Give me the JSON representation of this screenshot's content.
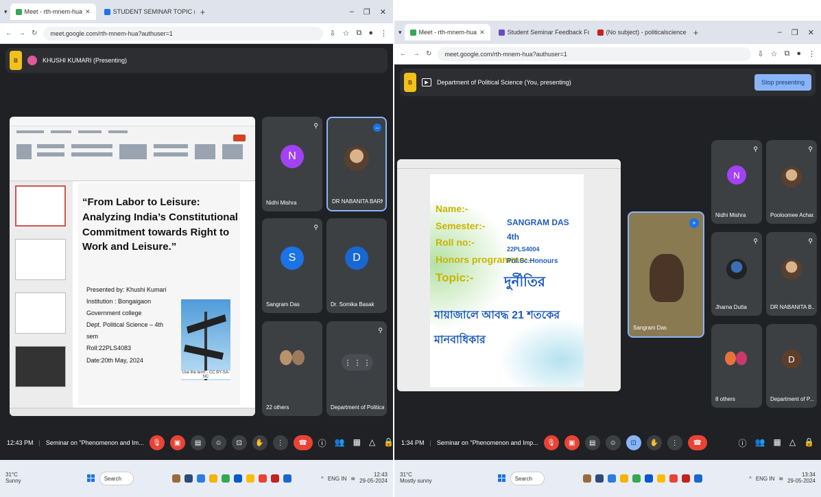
{
  "left": {
    "tabs": [
      {
        "label": "Meet - rth-mnem-hua",
        "active": true
      },
      {
        "label": "STUDENT SEMINAR TOPIC (S...",
        "active": false
      }
    ],
    "url": "meet.google.com/rth-mnem-hua?authuser=1",
    "presenter_label": "KHUSHI KUMARI (Presenting)",
    "slide": {
      "title": "“From Labor to Leisure: Analyzing India’s Constitutional Commitment towards Right to Work and Leisure.”",
      "info": [
        "Presented by: Khushi Kumari",
        "Institution : Bongaigaon",
        "Government college",
        "Dept. Political Science – 4th sem",
        "Roll:22PLS4083",
        "Date:20th May, 2024"
      ],
      "image_caption": "Use the term - CC BY-SA-NC"
    },
    "participants": [
      {
        "name": "Nidhi Mishra",
        "initial": "N",
        "color": "#a142f4"
      },
      {
        "name": "DR NABANITA BARMAN",
        "initial": "",
        "color": ""
      },
      {
        "name": "Sangram Das",
        "initial": "S",
        "color": "#1a73e8"
      },
      {
        "name": "Dr. Somika Basak",
        "initial": "D",
        "color": "#1967d2"
      },
      {
        "name": "22 others",
        "initial": "",
        "color": ""
      },
      {
        "name": "Department of Political...",
        "initial": "",
        "color": ""
      }
    ],
    "time": "12:43 PM",
    "meeting": "Seminar on \"Phenomenon and Im...",
    "weather": {
      "temp": "31°C",
      "desc": "Sunny"
    },
    "search": "Search",
    "clock": {
      "time": "12:43",
      "date": "29-05-2024"
    },
    "tray_lang": "ENG IN"
  },
  "right": {
    "tabs": [
      {
        "label": "Meet - rth-mnem-hua",
        "active": true
      },
      {
        "label": "Student Seminar Feedback For",
        "active": false
      },
      {
        "label": "(No subject) - politicalscience",
        "active": false
      }
    ],
    "url": "meet.google.com/rth-mnem-hua?authuser=1",
    "presenter_label": "Department of Political Science (You, presenting)",
    "stop_label": "Stop presenting",
    "slide": {
      "labels": [
        "Name:-",
        "Semester:-",
        "Roll no:-",
        "Honors programme:-",
        "Topic:-"
      ],
      "values": [
        "SANGRAM DAS",
        "4th",
        "22PLS4004",
        "Pol.Sc.Honours"
      ],
      "topic_word": "দুর্নীতির",
      "line1": "মায়াজালে আবদ্ধ 21 শতকের",
      "line2": "মানবাধিকার"
    },
    "self_view_name": "Sangram Das",
    "participants": [
      {
        "name": "Nidhi Mishra",
        "initial": "N",
        "color": "#a142f4"
      },
      {
        "name": "Pooloomee Achar...",
        "initial": "",
        "color": ""
      },
      {
        "name": "Jharna Dutta",
        "initial": "",
        "color": ""
      },
      {
        "name": "DR NABANITA B...",
        "initial": "",
        "color": ""
      },
      {
        "name": "8 others",
        "initial": "",
        "color": ""
      },
      {
        "name": "Department of P...",
        "initial": "D",
        "color": "#5f3d2b"
      }
    ],
    "time": "1:34 PM",
    "meeting": "Seminar on \"Phenomenon and Imp...",
    "weather": {
      "temp": "31°C",
      "desc": "Mostly sunny"
    },
    "search": "Search",
    "clock": {
      "time": "13:34",
      "date": "29-05-2024"
    },
    "tray_lang": "ENG IN"
  },
  "colors": {
    "meet_bg": "#202124",
    "tile_bg": "#3c4043",
    "end_call": "#ea4335",
    "accent": "#8ab4f8"
  }
}
